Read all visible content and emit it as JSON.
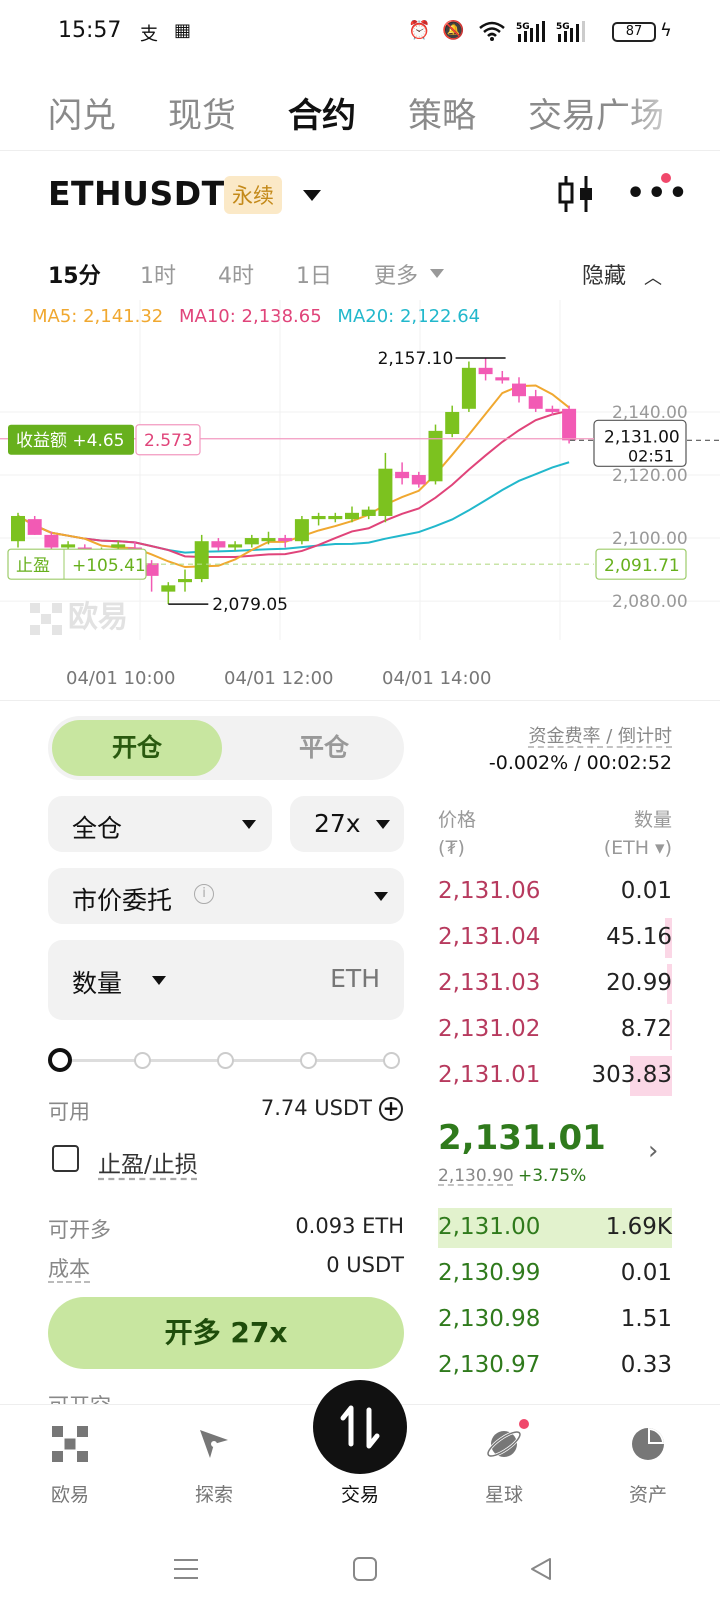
{
  "status_bar": {
    "time": "15:57",
    "battery": "87",
    "icons": [
      "alipay-icon",
      "okx-icon",
      "alarm-icon",
      "mute-icon",
      "wifi-icon",
      "signal-5g-icon",
      "signal-5g-icon",
      "battery-icon",
      "charging-icon"
    ]
  },
  "top_tabs": [
    "闪兑",
    "现货",
    "合约",
    "策略",
    "交易广场"
  ],
  "active_top_tab": "合约",
  "symbol": {
    "name": "ETHUSDT",
    "badge": "永续"
  },
  "timeframes": [
    "15分",
    "1时",
    "4时",
    "1日",
    "更多"
  ],
  "active_timeframe": "15分",
  "hide_label": "隐藏",
  "chart_data": {
    "type": "candlestick",
    "ma": {
      "ma5": "MA5: 2,141.32",
      "ma10": "MA10: 2,138.65",
      "ma20": "MA20: 2,122.64"
    },
    "ma_colors": {
      "ma5": "#f0a830",
      "ma10": "#e0447a",
      "ma20": "#22b8cc"
    },
    "up_color": "#7cc21f",
    "down_color": "#f25ab4",
    "y_ticks": [
      "2,140.00",
      "2,120.00",
      "2,100.00",
      "2,080.00"
    ],
    "x_ticks": [
      "04/01 10:00",
      "04/01 12:00",
      "04/01 14:00"
    ],
    "ylim": [
      2074,
      2166
    ],
    "high_annotation": "2,157.10",
    "low_annotation": "2,079.05",
    "current_price": "2,131.00",
    "countdown": "02:51",
    "pnl_label": "收益额 +4.65",
    "pnl_entry": "2.573",
    "tp_label": "止盈",
    "tp_value": "+105.41",
    "tp_price": "2,091.71",
    "watermark": "欧易",
    "candles": [
      {
        "o": 2099,
        "h": 2108,
        "l": 2097,
        "c": 2107
      },
      {
        "o": 2106,
        "h": 2107,
        "l": 2101,
        "c": 2101
      },
      {
        "o": 2101,
        "h": 2102,
        "l": 2096,
        "c": 2097
      },
      {
        "o": 2097,
        "h": 2099,
        "l": 2095,
        "c": 2098
      },
      {
        "o": 2097,
        "h": 2098,
        "l": 2093,
        "c": 2096
      },
      {
        "o": 2096,
        "h": 2097,
        "l": 2094,
        "c": 2096
      },
      {
        "o": 2097,
        "h": 2099,
        "l": 2096,
        "c": 2098
      },
      {
        "o": 2097,
        "h": 2099,
        "l": 2095,
        "c": 2096
      },
      {
        "o": 2092,
        "h": 2093,
        "l": 2083,
        "c": 2088
      },
      {
        "o": 2083,
        "h": 2086,
        "l": 2079.05,
        "c": 2085
      },
      {
        "o": 2086,
        "h": 2090,
        "l": 2083,
        "c": 2087
      },
      {
        "o": 2087,
        "h": 2101,
        "l": 2086,
        "c": 2099
      },
      {
        "o": 2099,
        "h": 2100,
        "l": 2096,
        "c": 2097
      },
      {
        "o": 2097,
        "h": 2099,
        "l": 2096,
        "c": 2098
      },
      {
        "o": 2098,
        "h": 2101,
        "l": 2097,
        "c": 2100
      },
      {
        "o": 2099,
        "h": 2102,
        "l": 2098,
        "c": 2100
      },
      {
        "o": 2100,
        "h": 2101,
        "l": 2097,
        "c": 2099
      },
      {
        "o": 2099,
        "h": 2107,
        "l": 2098,
        "c": 2106
      },
      {
        "o": 2106,
        "h": 2108,
        "l": 2104,
        "c": 2107
      },
      {
        "o": 2106,
        "h": 2108,
        "l": 2105,
        "c": 2107
      },
      {
        "o": 2106,
        "h": 2110,
        "l": 2105,
        "c": 2108
      },
      {
        "o": 2107,
        "h": 2110,
        "l": 2106,
        "c": 2109
      },
      {
        "o": 2107,
        "h": 2127,
        "l": 2105,
        "c": 2122
      },
      {
        "o": 2121,
        "h": 2124,
        "l": 2117,
        "c": 2119
      },
      {
        "o": 2120,
        "h": 2121,
        "l": 2116,
        "c": 2117
      },
      {
        "o": 2118,
        "h": 2136,
        "l": 2117,
        "c": 2134
      },
      {
        "o": 2133,
        "h": 2142,
        "l": 2132,
        "c": 2140
      },
      {
        "o": 2141,
        "h": 2156,
        "l": 2140,
        "c": 2154
      },
      {
        "o": 2154,
        "h": 2157.1,
        "l": 2150,
        "c": 2152
      },
      {
        "o": 2151,
        "h": 2153,
        "l": 2149,
        "c": 2150
      },
      {
        "o": 2149,
        "h": 2151,
        "l": 2143,
        "c": 2145
      },
      {
        "o": 2145,
        "h": 2147,
        "l": 2140,
        "c": 2141
      },
      {
        "o": 2141,
        "h": 2142,
        "l": 2139,
        "c": 2140
      },
      {
        "o": 2141,
        "h": 2142,
        "l": 2130,
        "c": 2131
      }
    ]
  },
  "trade": {
    "open_tab": "开仓",
    "close_tab": "平仓",
    "margin_mode": "全仓",
    "leverage": "27x",
    "order_type": "市价委托",
    "amount_label": "数量",
    "amount_unit": "ETH",
    "slider_percent": 0,
    "available_label": "可用",
    "available_value": "7.74 USDT",
    "tpsl_label": "止盈/止损",
    "max_long_label": "可开多",
    "max_long_value": "0.093 ETH",
    "cost_label": "成本",
    "cost_value": "0 USDT",
    "long_button": "开多 27x",
    "next_row_label": "可开空"
  },
  "order_book": {
    "funding_label": "资金费率 / 倒计时",
    "funding_value": "-0.002% / 00:02:52",
    "price_header": "价格",
    "price_unit": "(₮)",
    "qty_header": "数量",
    "qty_unit": "(ETH ▾)",
    "asks": [
      {
        "price": "2,131.06",
        "qty": "0.01",
        "depth": 0.0
      },
      {
        "price": "2,131.04",
        "qty": "45.16",
        "depth": 0.03
      },
      {
        "price": "2,131.03",
        "qty": "20.99",
        "depth": 0.02
      },
      {
        "price": "2,131.02",
        "qty": "8.72",
        "depth": 0.01
      },
      {
        "price": "2,131.01",
        "qty": "303.83",
        "depth": 0.18
      }
    ],
    "last_price": "2,131.01",
    "mark_price": "2,130.90",
    "change": "+3.75%",
    "bids": [
      {
        "price": "2,131.00",
        "qty": "1.69K",
        "depth": 1.0
      },
      {
        "price": "2,130.99",
        "qty": "0.01",
        "depth": 0.0
      },
      {
        "price": "2,130.98",
        "qty": "1.51",
        "depth": 0.0
      },
      {
        "price": "2,130.97",
        "qty": "0.33",
        "depth": 0.0
      }
    ]
  },
  "bottom_nav": [
    {
      "label": "欧易",
      "icon": "okx-logo-icon"
    },
    {
      "label": "探索",
      "icon": "compass-icon"
    },
    {
      "label": "交易",
      "icon": "trade-swap-icon"
    },
    {
      "label": "星球",
      "icon": "planet-icon"
    },
    {
      "label": "资产",
      "icon": "pie-chart-icon"
    }
  ],
  "active_nav": "交易"
}
